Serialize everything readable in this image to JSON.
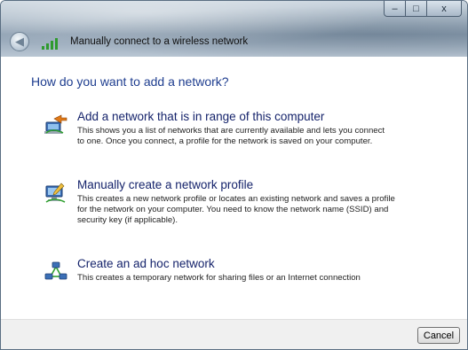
{
  "window": {
    "title": "Manually connect to a wireless network",
    "controls": {
      "minimize": "–",
      "maximize": "□",
      "close": "x"
    }
  },
  "content": {
    "heading": "How do you want to add a network?",
    "options": [
      {
        "title": "Add a network that is in range of this computer",
        "desc_line1": "This shows you a list of networks that are currently available and lets you connect",
        "desc_line2": "to one. Once you connect, a profile for the network is saved on your computer.",
        "icon": "network-add-icon"
      },
      {
        "title": "Manually create a network profile",
        "desc_line1": "This creates a new network profile or locates an existing network and saves a profile",
        "desc_line2": "for the network on your computer. You need to know the network name (SSID) and",
        "desc_line3": "security key (if applicable).",
        "icon": "network-profile-icon"
      },
      {
        "title": "Create an ad hoc network",
        "desc_line1": "This creates a temporary network for sharing files or an Internet connection",
        "icon": "adhoc-network-icon"
      }
    ]
  },
  "footer": {
    "cancel_label": "Cancel"
  },
  "colors": {
    "heading": "#1e3d8f",
    "option_title": "#15236b",
    "signal_green": "#2f9a2f"
  }
}
